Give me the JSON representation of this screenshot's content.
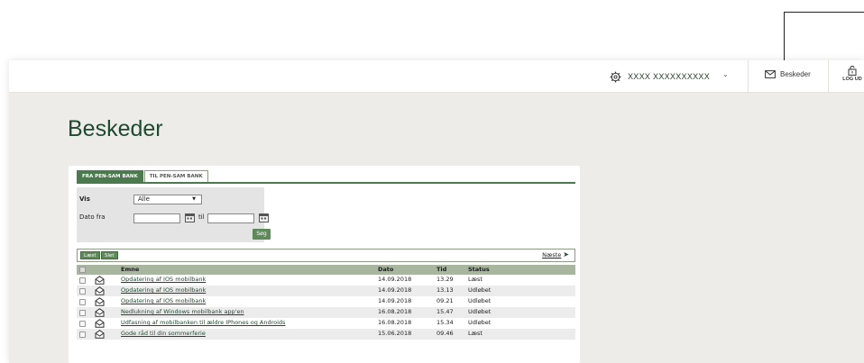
{
  "topbar": {
    "account_name": "XXXX XXXXXXXXXX",
    "messages_label": "Beskeder",
    "logout_label": "LOG UD"
  },
  "page": {
    "title": "Beskeder"
  },
  "tabs": [
    {
      "label": "FRA PEN-SAM BANK",
      "active": true
    },
    {
      "label": "TIL PEN-SAM BANK",
      "active": false
    }
  ],
  "filter": {
    "show_label": "Vis",
    "show_value": "Alle",
    "date_from_label": "Dato fra",
    "date_to_label": "til",
    "date_from_value": "",
    "date_to_value": "",
    "search_button": "Søg"
  },
  "actions": {
    "read_button": "Læst",
    "delete_button": "Slet",
    "next_label": "Næste"
  },
  "table": {
    "headers": {
      "subject": "Emne",
      "date": "Dato",
      "time": "Tid",
      "status": "Status"
    },
    "rows": [
      {
        "subject": "Opdatering af IOS mobilbank",
        "date": "14.09.2018",
        "time": "13.29",
        "status": "Læst"
      },
      {
        "subject": "Opdatering af IOS mobilbank",
        "date": "14.09.2018",
        "time": "13.13",
        "status": "Udløbet"
      },
      {
        "subject": "Opdatering af IOS mobilbank",
        "date": "14.09.2018",
        "time": "09.21",
        "status": "Udløbet"
      },
      {
        "subject": "Nedlukning af Windows mobilbank app'en",
        "date": "16.08.2018",
        "time": "15.47",
        "status": "Udløbet"
      },
      {
        "subject": "Udfasning af mobilbanken til ældre IPhones og Androids",
        "date": "16.08.2018",
        "time": "15.34",
        "status": "Udløbet"
      },
      {
        "subject": "Gode råd til din sommerferie",
        "date": "15.06.2018",
        "time": "09.46",
        "status": "Læst"
      }
    ]
  },
  "colors": {
    "brand_green": "#4b7a4e",
    "title_green": "#1f4a30",
    "background": "#eeece8"
  }
}
